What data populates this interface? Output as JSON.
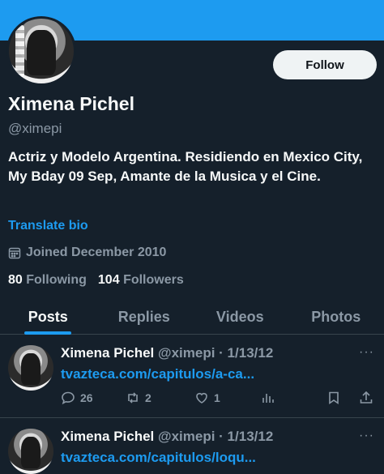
{
  "profile": {
    "display_name": "Ximena Pichel",
    "handle": "@ximepi",
    "follow_label": "Follow",
    "bio": "Actriz y Modelo Argentina. Residiendo en Mexico City, My Bday 09 Sep, Amante de la Musica y el Cine.",
    "translate_label": "Translate bio",
    "joined": "Joined December 2010",
    "following_count": "80",
    "following_label": "Following",
    "followers_count": "104",
    "followers_label": "Followers",
    "banner_color": "#1d9bf0",
    "avatar_icon": "profile-photo"
  },
  "tabs": [
    {
      "label": "Posts",
      "active": true
    },
    {
      "label": "Replies",
      "active": false
    },
    {
      "label": "Videos",
      "active": false
    },
    {
      "label": "Photos",
      "active": false
    }
  ],
  "tweets": [
    {
      "name": "Ximena Pichel",
      "meta": "@ximepi · 1/13/12",
      "more": "···",
      "link": "tvazteca.com/capitulos/a-ca...",
      "replies": "26",
      "reposts": "2",
      "likes": "1"
    },
    {
      "name": "Ximena Pichel",
      "meta": "@ximepi · 1/13/12",
      "more": "···",
      "link": "tvazteca.com/capitulos/loqu..."
    }
  ],
  "colors": {
    "background": "#15202b",
    "accent": "#1d9bf0",
    "muted_text": "#8b98a5",
    "divider": "#38444d"
  }
}
